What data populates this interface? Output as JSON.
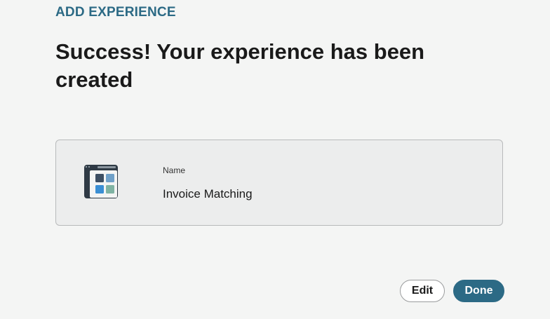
{
  "header": {
    "eyebrow": "ADD EXPERIENCE",
    "title": "Success! Your experience has been created"
  },
  "experience_card": {
    "icon": "app-grid-icon",
    "name_label": "Name",
    "name_value": "Invoice Matching"
  },
  "actions": {
    "edit_label": "Edit",
    "done_label": "Done"
  },
  "colors": {
    "accent": "#2c6a85",
    "background": "#f4f5f4",
    "card_background": "#eceded",
    "icon_dark": "#2f3a45",
    "icon_tile_blue": "#3b8fd4",
    "icon_tile_light_blue": "#6fa0c8",
    "icon_tile_green": "#7fb3a3"
  }
}
